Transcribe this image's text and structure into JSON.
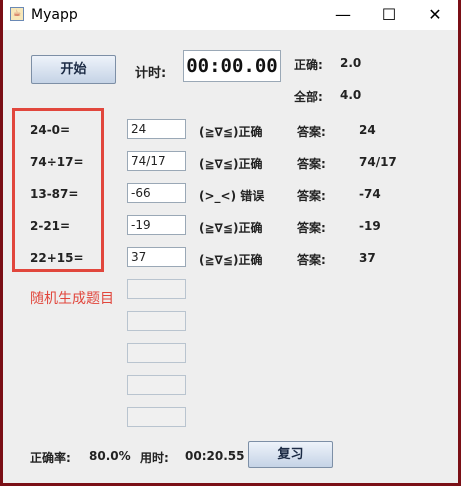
{
  "window": {
    "title": "Myapp",
    "icon": "java-cup-icon",
    "controls": {
      "minimize": "—",
      "maximize": "☐",
      "close": "✕"
    }
  },
  "top": {
    "start_label": "开始",
    "timer_label": "计时:",
    "timer_value": "00:00.00",
    "correct_label": "正确:",
    "correct_value": "2.0",
    "total_label": "全部:",
    "total_value": "4.0"
  },
  "questions": [
    {
      "expr": "24-0=",
      "input": "24",
      "status": "(≧∇≦)正确",
      "answer_label": "答案:",
      "answer": "24"
    },
    {
      "expr": "74÷17=",
      "input": "74/17",
      "status": "(≧∇≦)正确",
      "answer_label": "答案:",
      "answer": "74/17"
    },
    {
      "expr": "13-87=",
      "input": "-66",
      "status": "(>_<) 错误",
      "answer_label": "答案:",
      "answer": "-74"
    },
    {
      "expr": "2-21=",
      "input": "-19",
      "status": "(≧∇≦)正确",
      "answer_label": "答案:",
      "answer": "-19"
    },
    {
      "expr": "22+15=",
      "input": "37",
      "status": "(≧∇≦)正确",
      "answer_label": "答案:",
      "answer": "37"
    }
  ],
  "empty_inputs": [
    "",
    "",
    "",
    "",
    ""
  ],
  "annotation": "随机生成题目",
  "footer": {
    "accuracy_label": "正确率:",
    "accuracy_value": "80.0%",
    "time_label": "用时:",
    "time_value": "00:20.55",
    "review_label": "复习"
  },
  "colors": {
    "annotation": "#e1463c",
    "button": "#c5d3e6"
  }
}
